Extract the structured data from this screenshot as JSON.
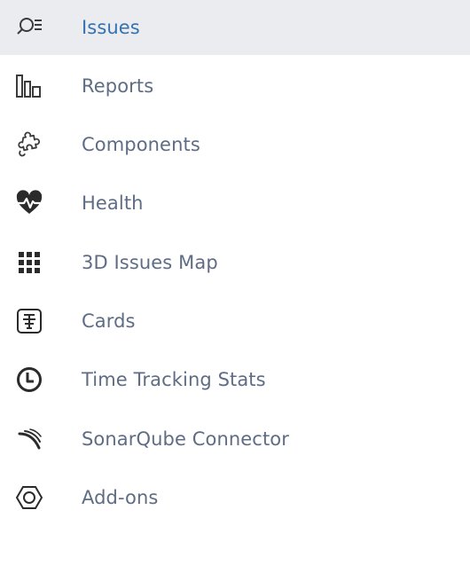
{
  "sidebar": {
    "active_index": 0,
    "accent_color": "#3572b0",
    "active_background": "#ebecf0",
    "items": [
      {
        "label": "Issues",
        "icon": "search-list-icon"
      },
      {
        "label": "Reports",
        "icon": "bar-chart-icon"
      },
      {
        "label": "Components",
        "icon": "puzzle-icon"
      },
      {
        "label": "Health",
        "icon": "heart-pulse-icon"
      },
      {
        "label": "3D Issues Map",
        "icon": "grid-icon"
      },
      {
        "label": "Cards",
        "icon": "cards-icon"
      },
      {
        "label": "Time Tracking Stats",
        "icon": "clock-icon"
      },
      {
        "label": "SonarQube Connector",
        "icon": "sonarqube-icon"
      },
      {
        "label": "Add-ons",
        "icon": "hexagon-nut-icon"
      }
    ]
  }
}
